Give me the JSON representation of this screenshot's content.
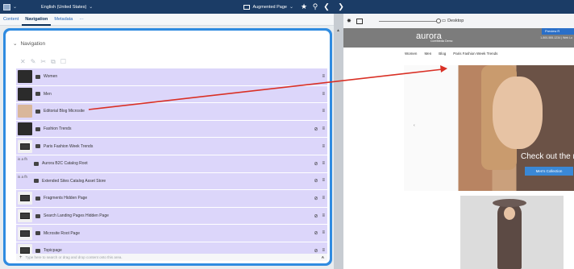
{
  "topbar": {
    "language": "English (United States)",
    "mode": "Augmented Page",
    "left_label": "Desktop"
  },
  "tabs": [
    {
      "label": "Content",
      "active": false
    },
    {
      "label": "Navigation",
      "active": true
    },
    {
      "label": "Metadata",
      "active": false
    },
    {
      "label": "···",
      "active": false
    }
  ],
  "nav": {
    "title": "Navigation",
    "rows": [
      {
        "label": "Women",
        "thumb": "dark",
        "thumb_text": "",
        "eye_off": false
      },
      {
        "label": "Men",
        "thumb": "dark",
        "thumb_text": "",
        "eye_off": false
      },
      {
        "label": "Editorial Blog Microsite",
        "thumb": "light",
        "thumb_text": "",
        "eye_off": false
      },
      {
        "label": "Fashion Trends",
        "thumb": "dark",
        "thumb_text": "",
        "eye_off": true
      },
      {
        "label": "Paris Fashion Week Trends",
        "thumb": "mon",
        "thumb_text": "",
        "eye_off": false
      },
      {
        "label": "Aurora B2C Catalog Root",
        "thumb": "txt",
        "thumb_text": "is a fh",
        "eye_off": true
      },
      {
        "label": "Extended Sites Catalog Asset Store",
        "thumb": "txt",
        "thumb_text": "is a fh",
        "eye_off": true
      },
      {
        "label": "Fragments Hidden Page",
        "thumb": "mon",
        "thumb_text": "",
        "eye_off": true
      },
      {
        "label": "Search Landing Pages Hidden Page",
        "thumb": "mon",
        "thumb_text": "",
        "eye_off": true
      },
      {
        "label": "Microsite Root Page",
        "thumb": "mon",
        "thumb_text": "",
        "eye_off": true
      },
      {
        "label": "Topicpage",
        "thumb": "mon",
        "thumb_text": "",
        "eye_off": true
      }
    ],
    "search_placeholder": "Type here to search or drag and drop content onto this area."
  },
  "preview": {
    "device_label": "Desktop",
    "site": {
      "logo": "aurora",
      "logo_sub": "CoreMedia Demo",
      "corner_text": "Preview R",
      "tiny_right": "1-800-555-1234  |  Web Lo",
      "nav": [
        "Women",
        "Men",
        "Blog",
        "Paris Fashion Week Trends"
      ],
      "hero_text": "Check out the n",
      "hero_button": "Men's Collection"
    }
  },
  "colors": {
    "topbar": "#1b3c66",
    "highlight_frame": "#2f8be0",
    "row_bg": "#dcd6fa",
    "arrow": "#d93025"
  }
}
